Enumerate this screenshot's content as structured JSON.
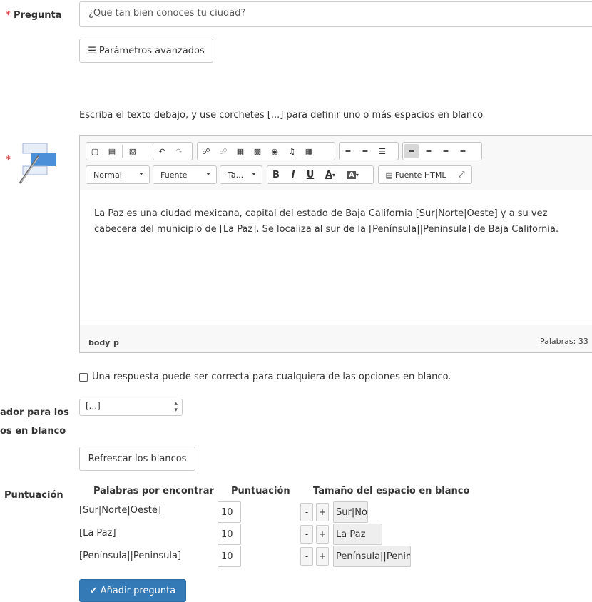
{
  "question": {
    "required_mark": "*",
    "label": "Pregunta",
    "value": "¿Que tan bien conoces tu ciudad?"
  },
  "advanced_button": {
    "icon": "menu-icon",
    "label": "Parámetros avanzados"
  },
  "instructions": "Escriba el texto debajo, y use corchetes [...] para definir uno o más espacios en blanco",
  "editor": {
    "required_mark": "*",
    "format_combo": "Normal",
    "font_combo": "Fuente",
    "size_combo": "Ta...",
    "bold": "B",
    "italic": "I",
    "underline": "U",
    "text_color": "A",
    "bg_color": "A",
    "source_label": "Fuente HTML",
    "content": "La Paz es una ciudad mexicana, capital del estado de Baja California [Sur|Norte|Oeste] y a su vez cabecera del municipio de [La Paz]. Se localiza al sur de la [Península||Peninsula] de Baja California.",
    "path_body": "body",
    "path_p": "p",
    "word_count": "Palabras: 33"
  },
  "any_option_checkbox": {
    "label": "Una respuesta puede ser correcta para cualquiera de las opciones en blanco.",
    "checked": false
  },
  "separator": {
    "label_line1": "ador para los",
    "label_line2": "os en blanco",
    "selected": "[...]"
  },
  "refresh_button": "Refrescar los blancos",
  "scoring": {
    "label": "Puntuación",
    "headers": {
      "words": "Palabras por encontrar",
      "score": "Puntuación",
      "size": "Tamaño del espacio en blanco"
    },
    "rows": [
      {
        "word": "[Sur|Norte|Oeste]",
        "score": "10",
        "minus": "-",
        "plus": "+",
        "preview": "Sur|Norte|Oeste"
      },
      {
        "word": "[La Paz]",
        "score": "10",
        "minus": "-",
        "plus": "+",
        "preview": "La Paz"
      },
      {
        "word": "[Península||Peninsula]",
        "score": "10",
        "minus": "-",
        "plus": "+",
        "preview": "Península||Peninsula"
      }
    ]
  },
  "submit_button": {
    "icon": "check-icon",
    "label": "Añadir pregunta"
  },
  "colors": {
    "required": "#d9534f",
    "primary": "#337ab7"
  }
}
